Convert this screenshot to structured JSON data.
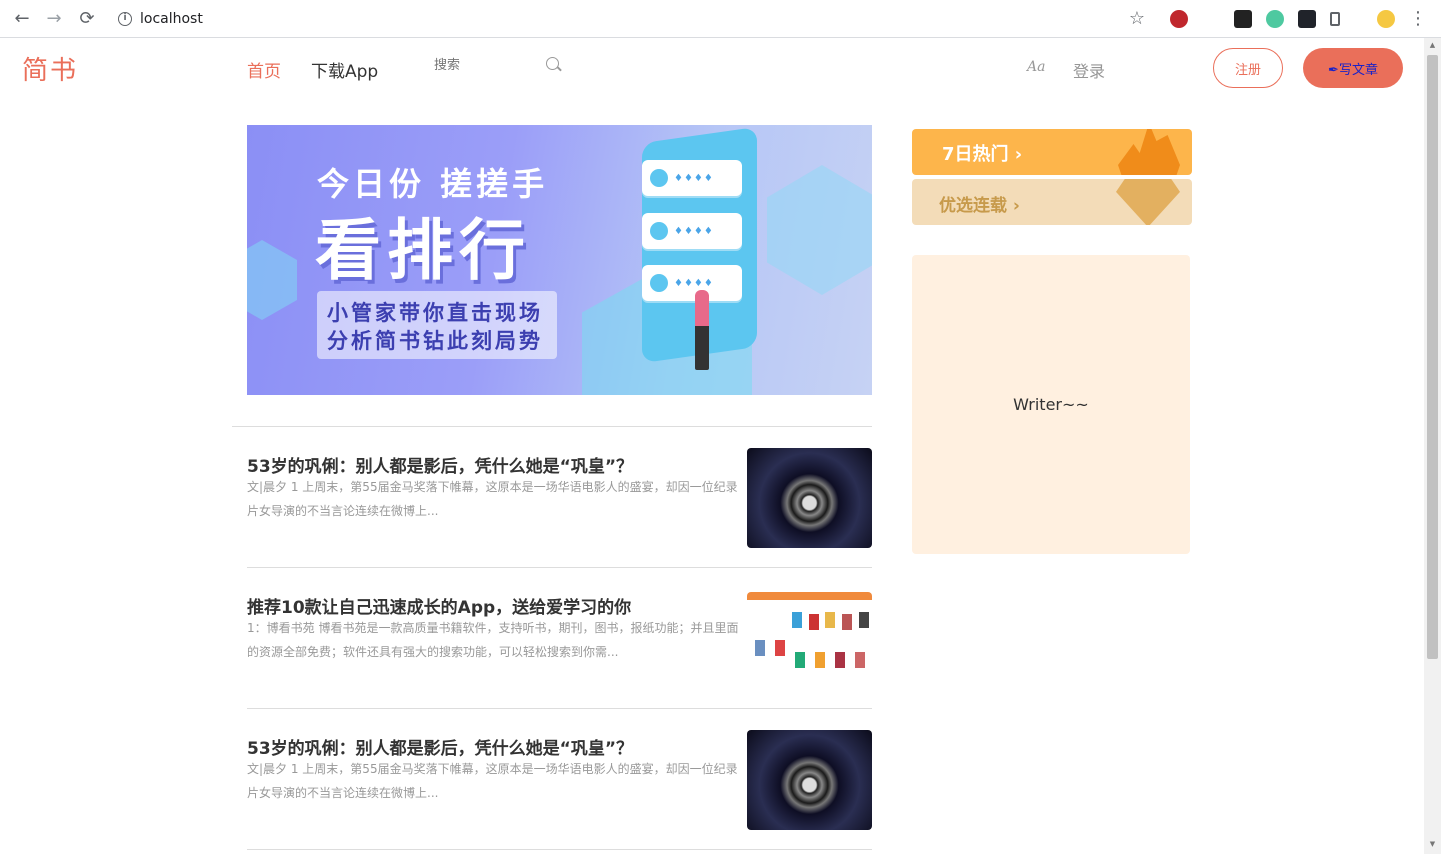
{
  "browser": {
    "url": "localhost",
    "back_icon": "←",
    "forward_icon": "→",
    "reload_icon": "⟳",
    "star_icon": "☆",
    "menu_icon": "⋮",
    "info_glyph": "i"
  },
  "header": {
    "logo": "简书",
    "nav_home": "首页",
    "nav_app": "下载App",
    "search_placeholder": "搜索",
    "aa": "Aa",
    "login": "登录",
    "register": "注册",
    "write": "✒写文章"
  },
  "banner": {
    "line1": "今日份 搓搓手",
    "line2": "看排行",
    "sub1": "小管家带你直击现场",
    "sub2": "分析简书钻此刻局势",
    "gems": "♦♦♦♦"
  },
  "articles": [
    {
      "title": "53岁的巩俐：别人都是影后，凭什么她是“巩皇”？",
      "abstract": "文|晨夕 1 上周末，第55届金马奖落下帷幕，这原本是一场华语电影人的盛宴，却因一位纪录片女导演的不当言论连续在微博上..."
    },
    {
      "title": "推荐10款让自己迅速成长的App，送给爱学习的你",
      "abstract": "1：博看书苑 博看书苑是一款高质量书籍软件，支持听书，期刊，图书，报纸功能；并且里面的资源全部免费；软件还具有强大的搜索功能，可以轻松搜索到你需..."
    },
    {
      "title": "53岁的巩俐：别人都是影后，凭什么她是“巩皇”？",
      "abstract": "文|晨夕 1 上周末，第55届金马奖落下帷幕，这原本是一场华语电影人的盛宴，却因一位纪录片女导演的不当言论连续在微博上..."
    }
  ],
  "sidebar": {
    "hot": "7日热门 ›",
    "serial": "优选连载 ›",
    "writer": "Writer~~"
  },
  "colors": {
    "accent": "#ea6f5a",
    "hot": "#fdb54b",
    "serial": "#f3dcb8",
    "writer_bg": "#fff0e0"
  }
}
